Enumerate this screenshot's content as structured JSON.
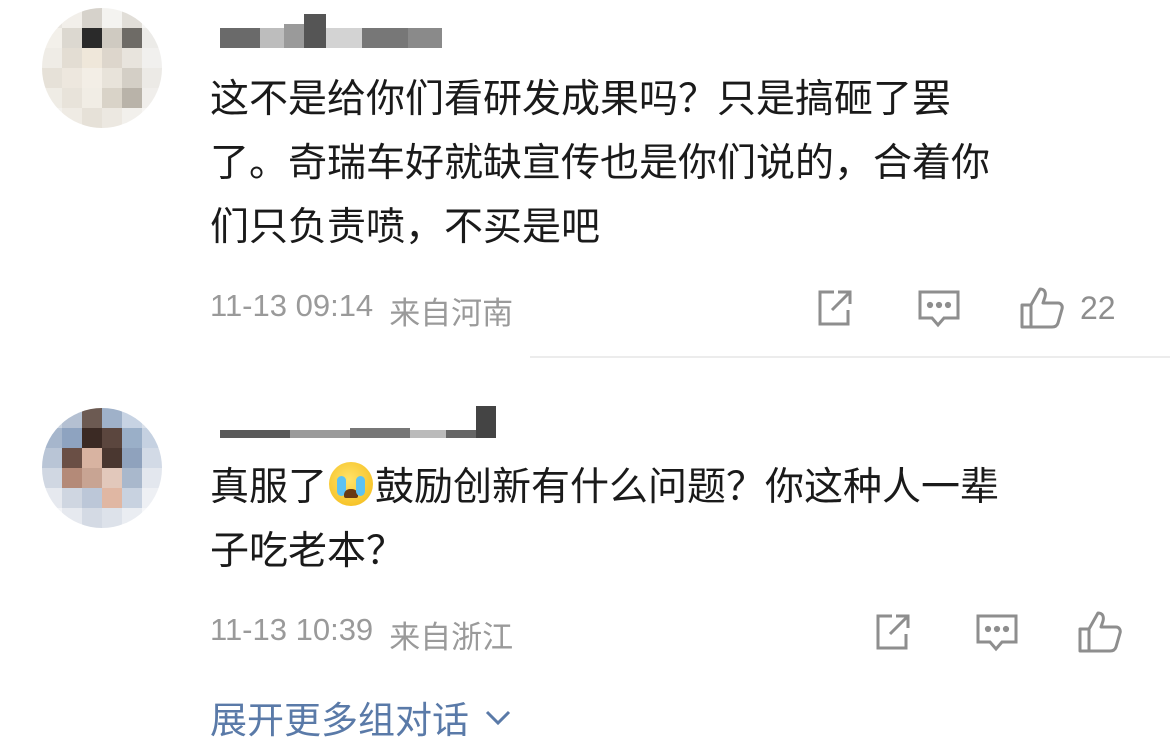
{
  "comments": [
    {
      "text": "这不是给你们看研发成果吗？只是搞砸了罢\n了。奇瑞车好就缺宣传也是你们说的，合着你\n们只负责喷，不买是吧",
      "time": "11-13 09:14",
      "location": "来自河南",
      "likes": "22"
    },
    {
      "text_before_emoji": "真服了",
      "emoji": "crying-face",
      "text_after_emoji": "鼓励创新有什么问题？你这种人一辈\n子吃老本？",
      "time": "11-13 10:39",
      "location": "来自浙江",
      "likes": ""
    }
  ],
  "expand_label": "展开更多组对话",
  "icons": [
    "share-icon",
    "reply-icon",
    "thumbs-up-icon",
    "chevron-down-icon"
  ],
  "colors": {
    "text": "#1a1a1a",
    "meta": "#9a9a9a",
    "link": "#5a7aa8",
    "icon": "#8e8e8e"
  }
}
